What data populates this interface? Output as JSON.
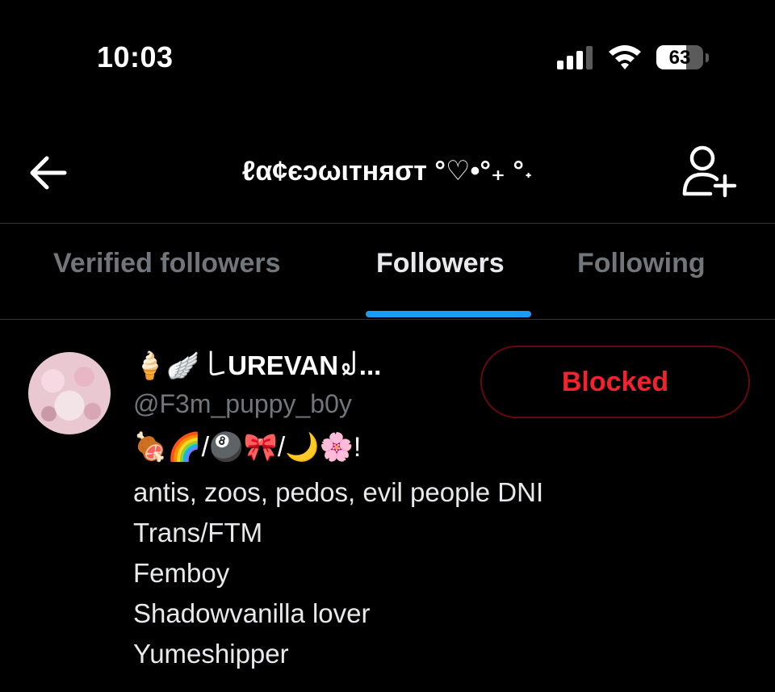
{
  "status_bar": {
    "time": "10:03",
    "battery_percent": "63",
    "battery_level": 0.63,
    "signal_bars_active": 3,
    "signal_bars_total": 4
  },
  "header": {
    "title": "ℓα¢єↄωιтняσт °♡•°₊ °˖",
    "back_icon": "arrow-left-icon",
    "add_user_icon": "person-add-icon"
  },
  "tabs": [
    {
      "label": "Verified followers",
      "active": false
    },
    {
      "label": "Followers",
      "active": true
    },
    {
      "label": "Following",
      "active": false
    }
  ],
  "follower": {
    "display_name": "🍦🪽 ꒒UREVAN꒻...",
    "handle": "@F3m_puppy_b0y",
    "button_label": "Blocked",
    "bio_emoji": "🍖🌈/🎱🎀/🌙🌸!",
    "bio_lines": [
      "antis, zoos, pedos, evil people DNI",
      "Trans/FTM",
      "Femboy",
      "Shadowvanilla lover",
      "Yumeshipper"
    ]
  },
  "colors": {
    "background": "#000000",
    "accent": "#1d9bf0",
    "blocked_red": "#f4212e",
    "muted_text": "#71767b",
    "divider": "#2f3336"
  }
}
